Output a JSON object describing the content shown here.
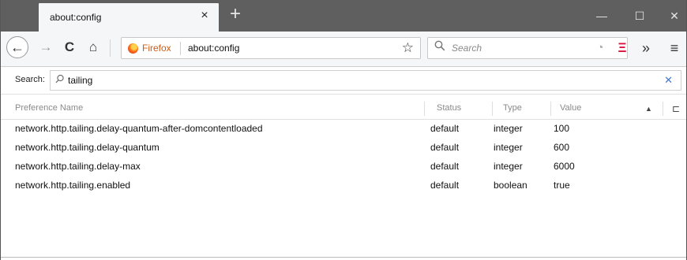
{
  "window": {
    "tab_title": "about:config",
    "tab_close": "×",
    "new_tab": "+",
    "minimize": "—",
    "maximize": "☐",
    "close": "✕"
  },
  "nav": {
    "back": "←",
    "forward": "→",
    "reload": "C",
    "home": "⌂",
    "url_brand": "Firefox",
    "url": "about:config",
    "bookmark": "☆",
    "search_placeholder": "Search",
    "rss": "◔",
    "reading": "Ξ",
    "overflow": "»",
    "menu": "≡"
  },
  "filter": {
    "label": "Search:",
    "value": "tailing",
    "clear": "✕"
  },
  "table": {
    "columns": [
      "Preference Name",
      "Status",
      "Type",
      "Value"
    ],
    "sort_arrow": "▲",
    "column_picker": "⊏",
    "rows": [
      {
        "name": "network.http.tailing.delay-quantum-after-domcontentloaded",
        "status": "default",
        "type": "integer",
        "value": "100"
      },
      {
        "name": "network.http.tailing.delay-quantum",
        "status": "default",
        "type": "integer",
        "value": "600"
      },
      {
        "name": "network.http.tailing.delay-max",
        "status": "default",
        "type": "integer",
        "value": "6000"
      },
      {
        "name": "network.http.tailing.enabled",
        "status": "default",
        "type": "boolean",
        "value": "true"
      }
    ]
  },
  "colors": {
    "titlebar": "#5f5f5f",
    "toolbar": "#f5f6f7",
    "brand": "#d25b10",
    "reading_list": "#d9123d",
    "clear": "#3a79d8"
  }
}
